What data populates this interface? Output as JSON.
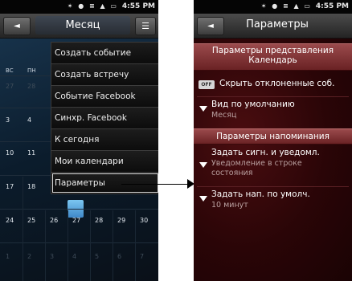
{
  "status": {
    "time": "4:55 PM",
    "icons": "✶ ● ≡ ▲ ▭"
  },
  "left": {
    "back_label": "◄",
    "title": "Месяц",
    "menu_button": "☰",
    "weekdays": [
      "ВС",
      "ПН"
    ],
    "rows": [
      [
        "27",
        "28"
      ],
      [
        "3",
        "4"
      ],
      [
        "10",
        "11"
      ],
      [
        "17",
        "18"
      ],
      [
        "24",
        "25",
        "26",
        "27",
        "28",
        "29",
        "30"
      ],
      [
        "1",
        "2",
        "3",
        "4",
        "5",
        "6",
        "7"
      ]
    ],
    "menu": [
      "Создать событие",
      "Создать встречу",
      "Событие Facebook",
      "Синхр. Facebook",
      "К сегодня",
      "Мои календари",
      "Параметры"
    ]
  },
  "right": {
    "back_label": "◄",
    "title": "Параметры",
    "section1_line1": "Параметры представления",
    "section1_line2": "Календарь",
    "toggle_label": "OFF",
    "hide_declined": "Скрыть отклоненные соб.",
    "default_view_label": "Вид по умолчанию",
    "default_view_value": "Месяц",
    "section2": "Параметры напоминания",
    "alert_label": "Задать сигн. и уведомл.",
    "alert_value_line1": "Уведомление в строке",
    "alert_value_line2": "состояния",
    "reminder_label": "Задать нап. по умолч.",
    "reminder_value": "10 минут"
  }
}
